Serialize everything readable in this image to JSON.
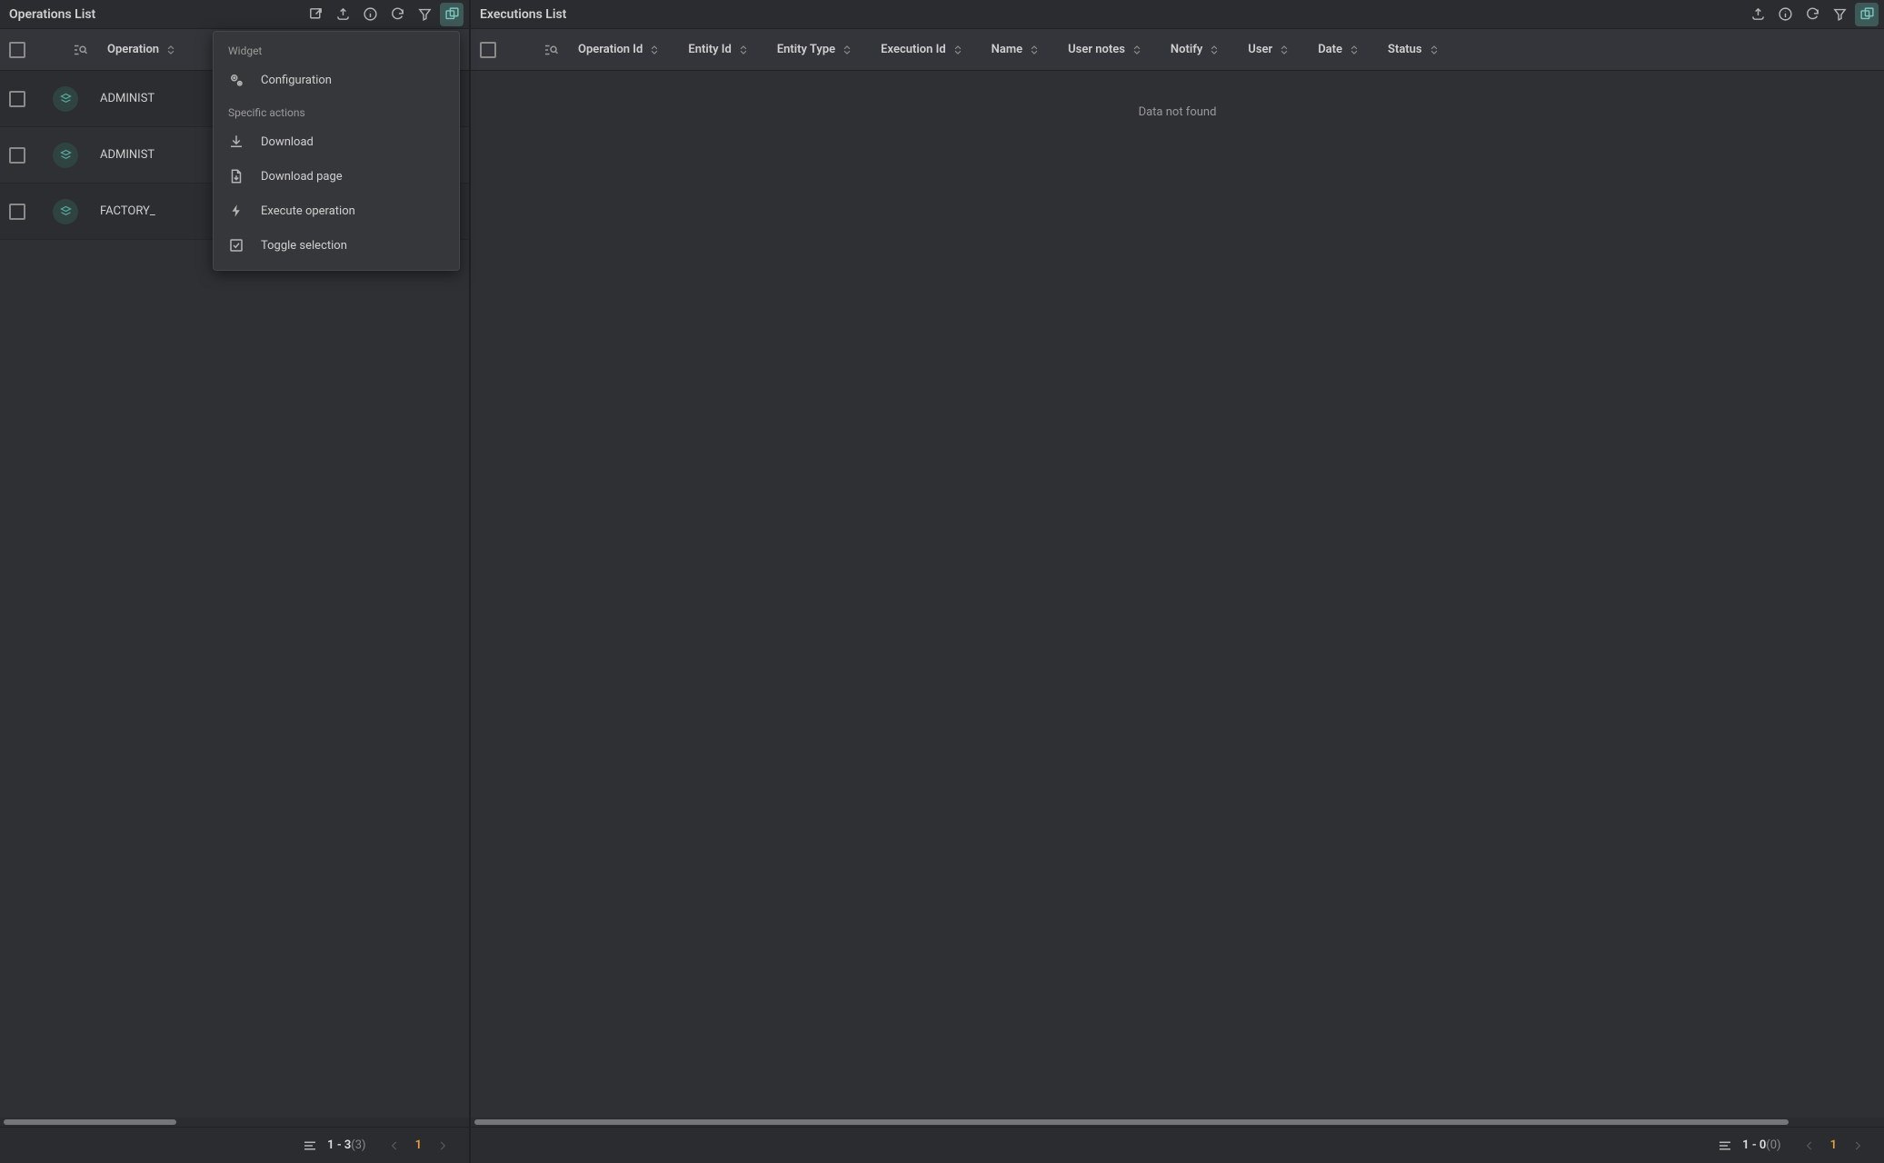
{
  "panels": {
    "operations": {
      "title": "Operations List",
      "columns": [
        "Operation"
      ],
      "rows": [
        {
          "name": "ADMINIST"
        },
        {
          "name": "ADMINIST"
        },
        {
          "name": "FACTORY_"
        }
      ],
      "footer": {
        "range": "1 - 3",
        "total": "(3)",
        "page": "1"
      }
    },
    "executions": {
      "title": "Executions List",
      "columns": [
        "Operation Id",
        "Entity Id",
        "Entity Type",
        "Execution Id",
        "Name",
        "User notes",
        "Notify",
        "User",
        "Date",
        "Status"
      ],
      "empty": "Data not found",
      "footer": {
        "range": "1 - 0",
        "total": "(0)",
        "page": "1"
      }
    }
  },
  "dropdown": {
    "section_widget": "Widget",
    "item_config": "Configuration",
    "section_actions": "Specific actions",
    "item_download": "Download",
    "item_download_page": "Download page",
    "item_execute": "Execute operation",
    "item_toggle": "Toggle selection"
  }
}
